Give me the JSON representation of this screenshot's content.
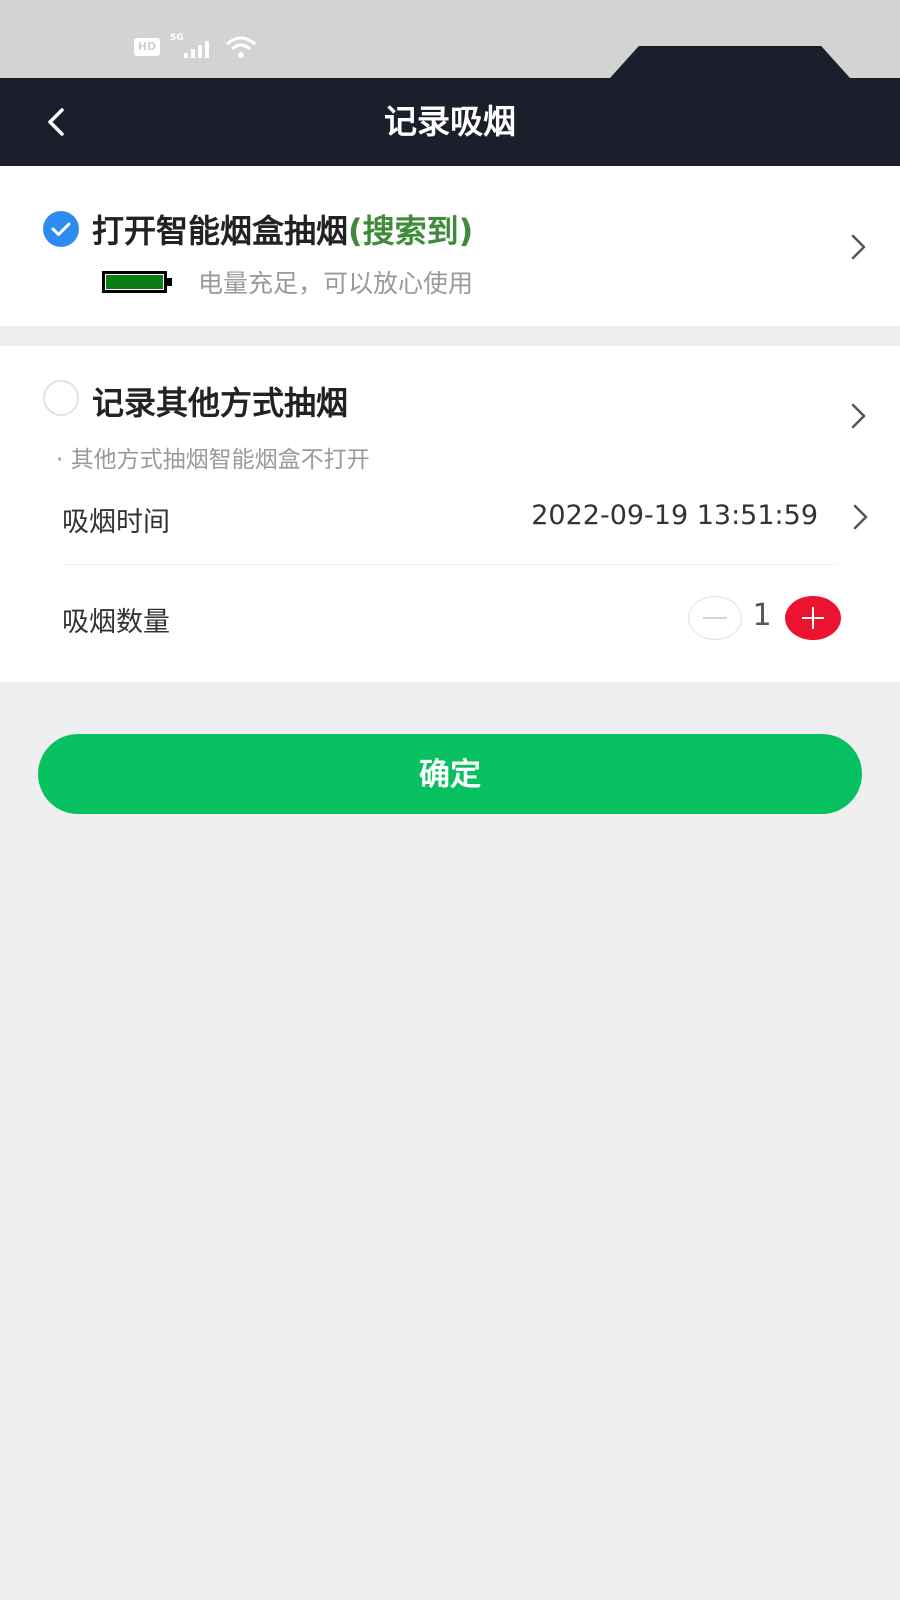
{
  "status_bar": {
    "hd_label": "HD",
    "network_label": "5G",
    "icons": [
      "hd-icon",
      "signal-icon",
      "wifi-icon"
    ]
  },
  "nav": {
    "title": "记录吸烟",
    "back_icon": "chevron-left-icon"
  },
  "smart_box_option": {
    "selected": true,
    "title": "打开智能烟盒抽烟",
    "status": "(搜索到)",
    "status_color": "#3f8b3a",
    "battery_level": 1.0,
    "battery_color": "#0a7d16",
    "battery_text": "电量充足，可以放心使用"
  },
  "other_option": {
    "selected": false,
    "title": "记录其他方式抽烟",
    "note": "· 其他方式抽烟智能烟盒不打开",
    "time_label": "吸烟时间",
    "time_value": "2022-09-19 13:51:59",
    "count_label": "吸烟数量",
    "count_value": "1"
  },
  "confirm_label": "确定",
  "colors": {
    "nav_background": "#1b1f2b",
    "accent_blue": "#2d8cf0",
    "confirm_green": "#07c160",
    "plus_red": "#ea1330",
    "page_background": "#efeff1"
  }
}
